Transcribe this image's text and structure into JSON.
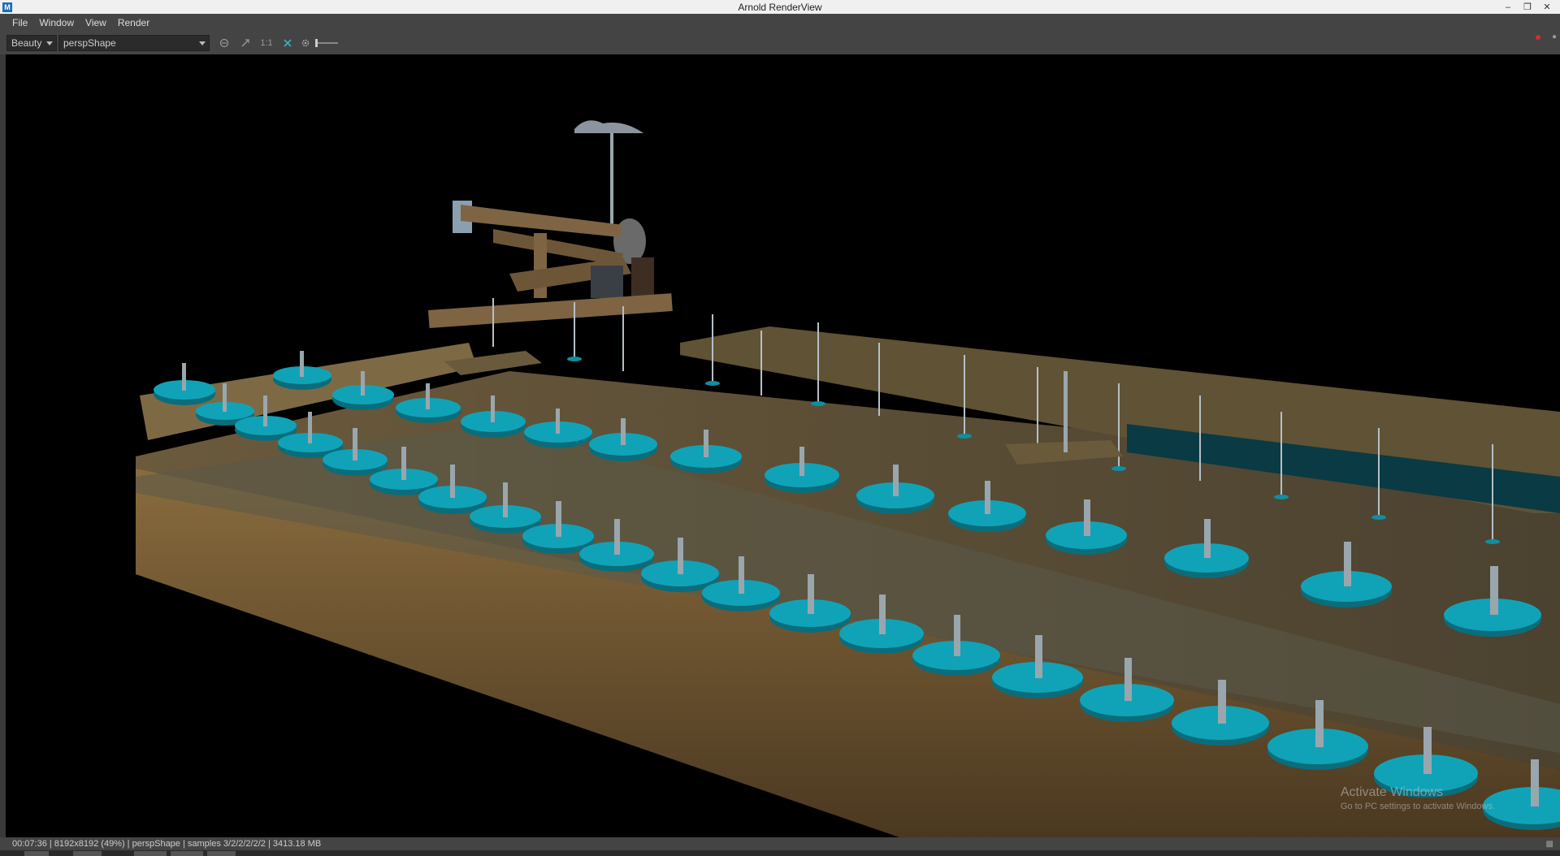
{
  "window": {
    "title": "Arnold RenderView",
    "app_icon": "M",
    "controls": [
      "–",
      "❒",
      "✕"
    ]
  },
  "menu": [
    "File",
    "Window",
    "View",
    "Render"
  ],
  "toolbar": {
    "aov": "Beauty",
    "camera": "perspShape",
    "icons": [
      "refresh-icon",
      "expand-icon",
      "1:1-icon",
      "crop-icon",
      "settings-icon"
    ],
    "ratio_label": "1:1"
  },
  "watermark": {
    "title": "Activate Windows",
    "subtitle": "Go to PC settings to activate Windows."
  },
  "status": {
    "text": "00:07:36 | 8192x8192 (49%) | perspShape  | samples 3/2/2/2/2/2 | 3413.18 MB"
  },
  "colors": {
    "wood": "#6e5a38",
    "wood_dark": "#4a3c24",
    "teal": "#10a3b8",
    "teal_dark": "#0b6d7b",
    "metal": "#9aa6ad"
  }
}
